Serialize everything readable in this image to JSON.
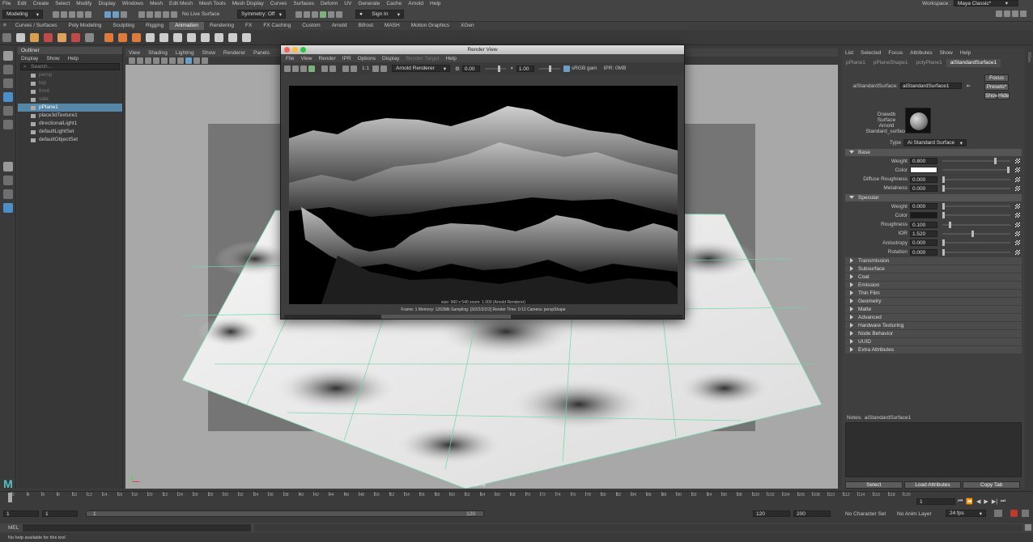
{
  "menubar": {
    "items": [
      "File",
      "Edit",
      "Create",
      "Select",
      "Modify",
      "Display",
      "Windows",
      "Mesh",
      "Edit Mesh",
      "Mesh Tools",
      "Mesh Display",
      "Curves",
      "Surfaces",
      "Deform",
      "UV",
      "Generate",
      "Cache",
      "Arnold",
      "Help"
    ],
    "workspace_label": "Workspace :",
    "workspace_value": "Maya Classic*"
  },
  "statusline": {
    "mode": "Modeling",
    "live_surface": "No Live Surface",
    "symmetry": "Symmetry: Off",
    "sign_in": "Sign In"
  },
  "shelf_tabs": [
    "Curves / Surfaces",
    "Poly Modeling",
    "Sculpting",
    "Rigging",
    "Animation",
    "Rendering",
    "FX",
    "FX Caching",
    "Custom",
    "Arnold",
    "Bifrost",
    "MASH",
    "Motion Graphics",
    "XGen"
  ],
  "active_shelf": "Animation",
  "outliner": {
    "title": "Outliner",
    "menu": [
      "Display",
      "Show",
      "Help"
    ],
    "search_placeholder": "Search...",
    "items": [
      {
        "label": "persp",
        "state": "dim"
      },
      {
        "label": "top",
        "state": "dim"
      },
      {
        "label": "front",
        "state": "dim"
      },
      {
        "label": "side",
        "state": "dim"
      },
      {
        "label": "pPlane1",
        "state": "sel"
      },
      {
        "label": "place3dTexture1",
        "state": "normal"
      },
      {
        "label": "directionalLight1",
        "state": "normal"
      },
      {
        "label": "defaultLightSet",
        "state": "normal"
      },
      {
        "label": "defaultObjectSet",
        "state": "normal"
      }
    ]
  },
  "viewport": {
    "menu": [
      "View",
      "Shading",
      "Lighting",
      "Show",
      "Renderer",
      "Panels"
    ],
    "camera_label": "persp"
  },
  "render_view": {
    "title": "Render View",
    "menu": [
      "File",
      "View",
      "Render",
      "IPR",
      "Options",
      "Display",
      "Render Target",
      "Help"
    ],
    "renderer": "Arnold Renderer",
    "exposure": "0.00",
    "gamma": "1.00",
    "color_space": "sRGB gam",
    "ipr": "IPR: 0MB",
    "ratio": "1:1",
    "info_line1": "size: 960 x 540 zoom: 1.000    (Arnold Renderer)",
    "info_line2": "Frame: 1    Memory: 1263Mb    Sampling: [3/2/2/2/2/2]    Render Time: 0:12    Camera: perspShape"
  },
  "attribute_editor": {
    "menu": [
      "List",
      "Selected",
      "Focus",
      "Attributes",
      "Show",
      "Help"
    ],
    "tabs": [
      "pPlane1",
      "pPlaneShape1",
      "polyPlane1",
      "aiStandardSurface1"
    ],
    "active_tab": "aiStandardSurface1",
    "node_label": "aiStandardSurface:",
    "node_name": "aiStandardSurface1",
    "focus_btn": "Focus",
    "presets_btn": "Presets*",
    "show_btn": "Show",
    "hide_btn": "Hide",
    "swatch_caption": [
      "Drawdb",
      "Surface",
      "Arnold",
      "Standard_surface"
    ],
    "type_label": "Type",
    "type_value": "Ai Standard Surface",
    "base_section": "Base",
    "base": [
      {
        "label": "Weight",
        "value": "0.800",
        "slider": 0.8
      },
      {
        "label": "Color",
        "value": "",
        "slider": 1.0,
        "swatch": "#ffffff"
      },
      {
        "label": "Diffuse Roughness",
        "value": "0.000",
        "slider": 0.0
      },
      {
        "label": "Metalness",
        "value": "0.000",
        "slider": 0.0
      }
    ],
    "specular_section": "Specular",
    "specular": [
      {
        "label": "Weight",
        "value": "0.000",
        "slider": 0.0
      },
      {
        "label": "Color",
        "value": "",
        "slider": 0.0,
        "swatch": "#1a1a1a"
      },
      {
        "label": "Roughness",
        "value": "0.100",
        "slider": 0.1
      },
      {
        "label": "IOR",
        "value": "1.520",
        "slider": 0.45
      },
      {
        "label": "Anisotropy",
        "value": "0.000",
        "slider": 0.0
      },
      {
        "label": "Rotation",
        "value": "0.000",
        "slider": 0.0
      }
    ],
    "collapsed_sections": [
      "Transmission",
      "Subsurface",
      "Coat",
      "Emission",
      "Thin Film",
      "Geometry",
      "Matte",
      "Advanced",
      "Hardware Texturing",
      "Node Behavior",
      "UUID",
      "Extra Attributes"
    ],
    "notes_label": "Notes:",
    "notes_node": "aiStandardSurface1",
    "bottom_buttons": [
      "Select",
      "Load Attributes",
      "Copy Tab"
    ]
  },
  "side_tabs": [
    "Channel Box / Layer Editor",
    "Modeling Toolkit",
    "Attribute Editor",
    "XGen"
  ],
  "timeline": {
    "ticks": [
      "2",
      "4",
      "6",
      "8",
      "10",
      "12",
      "14",
      "16",
      "18",
      "20",
      "22",
      "24",
      "26",
      "28",
      "30",
      "32",
      "34",
      "36",
      "38",
      "40",
      "42",
      "44",
      "46",
      "48",
      "50",
      "52",
      "54",
      "56",
      "58",
      "60",
      "62",
      "64",
      "66",
      "68",
      "70",
      "72",
      "74",
      "76",
      "78",
      "80",
      "82",
      "84",
      "86",
      "88",
      "90",
      "92",
      "94",
      "96",
      "98",
      "100",
      "102",
      "104",
      "106",
      "108",
      "110",
      "112",
      "114",
      "116",
      "118",
      "120"
    ],
    "current_frame": "1"
  },
  "range": {
    "start": "1",
    "start2": "1",
    "slider_start": "1",
    "slider_end": "120",
    "end": "120",
    "end2": "200",
    "character_set": "No Character Set",
    "anim_layer": "No Anim Layer",
    "fps": "24 fps"
  },
  "cmdline": {
    "label": "MEL"
  },
  "helpline": {
    "text": "No help available for this tool"
  },
  "colors": {
    "selection": "#5487a8",
    "accent_green": "#6fd9a8"
  }
}
